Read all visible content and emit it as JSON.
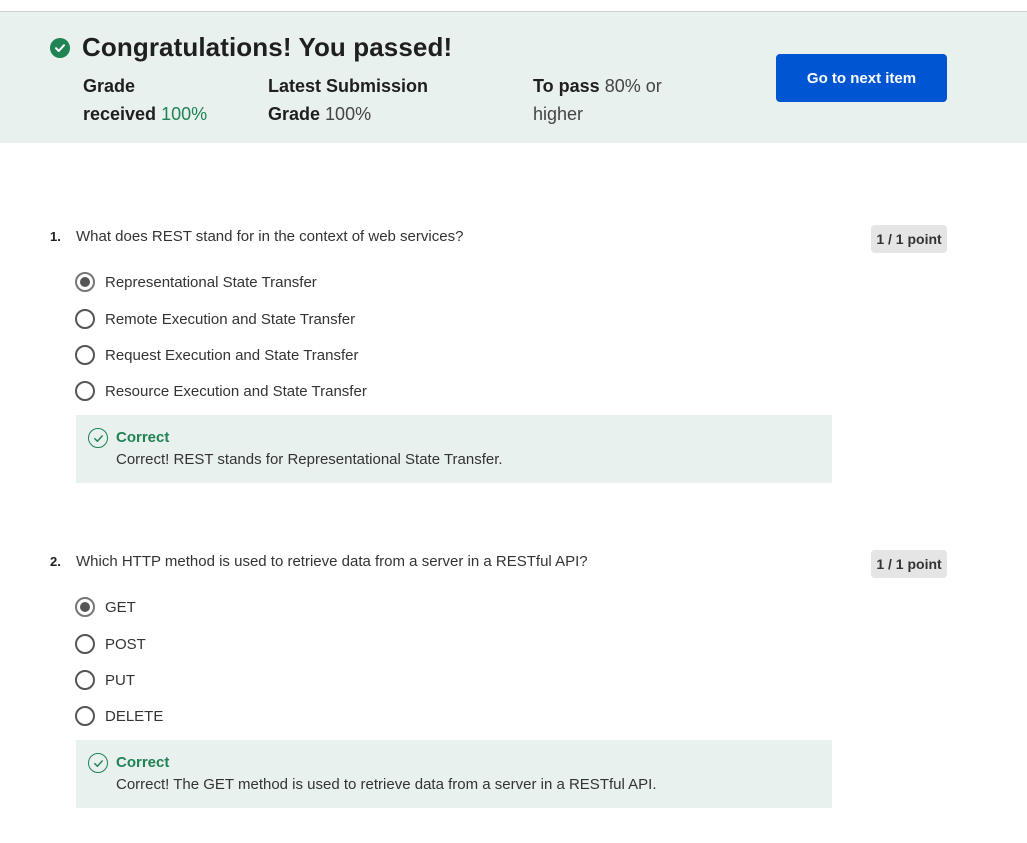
{
  "banner": {
    "title": "Congratulations! You passed!",
    "grade_received_label_1": "Grade",
    "grade_received_label_2": "received",
    "grade_received_value": "100%",
    "latest_label_1": "Latest Submission",
    "latest_label_2": "Grade",
    "latest_value": "100%",
    "to_pass_label": "To pass",
    "to_pass_value_1": "80% or",
    "to_pass_value_2": "higher",
    "next_button": "Go to next item",
    "accent_color": "#0056d2",
    "success_color": "#1f8354"
  },
  "questions": [
    {
      "number": "1.",
      "text": "What does REST stand for in the context of web services?",
      "points": "1 / 1 point",
      "options": [
        {
          "label": "Representational State Transfer",
          "selected": true
        },
        {
          "label": "Remote Execution and State Transfer",
          "selected": false
        },
        {
          "label": "Request Execution and State Transfer",
          "selected": false
        },
        {
          "label": "Resource Execution and State Transfer",
          "selected": false
        }
      ],
      "feedback_title": "Correct",
      "feedback_text": "Correct! REST stands for Representational State Transfer."
    },
    {
      "number": "2.",
      "text": "Which HTTP method is used to retrieve data from a server in a RESTful API?",
      "points": "1 / 1 point",
      "options": [
        {
          "label": "GET",
          "selected": true
        },
        {
          "label": "POST",
          "selected": false
        },
        {
          "label": "PUT",
          "selected": false
        },
        {
          "label": "DELETE",
          "selected": false
        }
      ],
      "feedback_title": "Correct",
      "feedback_text": "Correct! The GET method is used to retrieve data from a server in a RESTful API."
    }
  ]
}
